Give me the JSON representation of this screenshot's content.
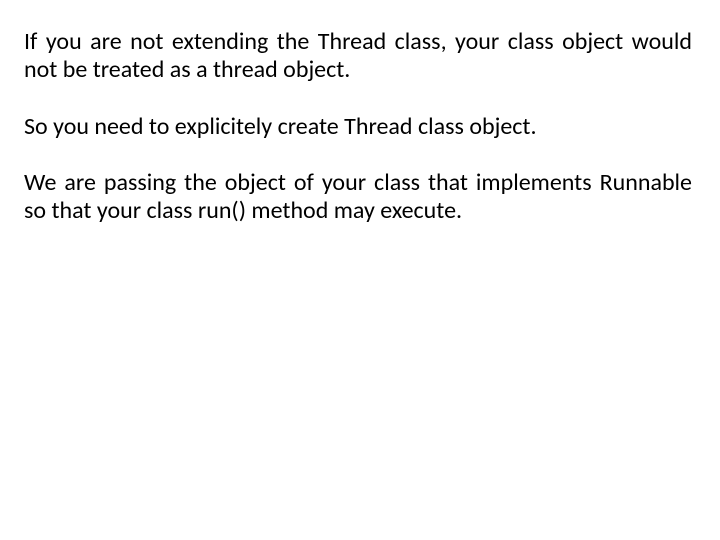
{
  "paragraphs": {
    "p1": "If you are not extending the Thread class, your class object would not be treated as a thread object.",
    "p2": "So you need to explicitely create Thread class object.",
    "p3": "We are passing the object of your class that implements Runnable so that your class run() method may execute."
  }
}
